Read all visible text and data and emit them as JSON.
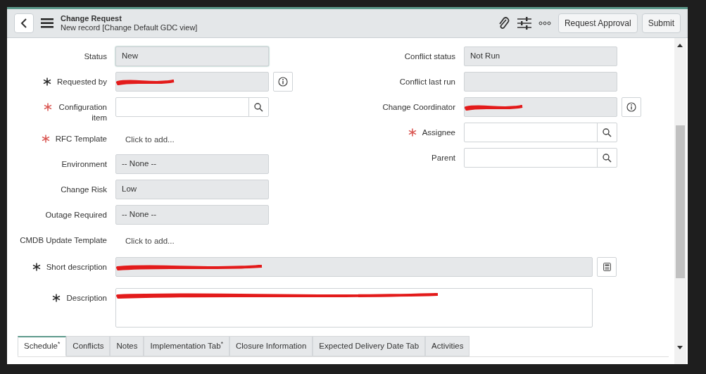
{
  "header": {
    "title": "Change Request",
    "subtitle": "New record [Change Default GDC view]",
    "buttons": [
      "Request Approval",
      "Submit"
    ]
  },
  "left_fields": [
    {
      "label": "Status",
      "kind": "text",
      "value": "New",
      "focused": true
    },
    {
      "label": "Requested by",
      "kind": "text",
      "mandatory": true,
      "mandatory_met": true,
      "redacted": true,
      "info": true
    },
    {
      "label": "Configuration item",
      "kind": "reference",
      "mandatory": true,
      "mandatory_met": false
    },
    {
      "label": "RFC Template",
      "kind": "click",
      "value": "Click to add...",
      "mandatory": true,
      "mandatory_met": false
    },
    {
      "label": "Environment",
      "kind": "text",
      "value": "-- None --"
    },
    {
      "label": "Change Risk",
      "kind": "text",
      "value": "Low"
    },
    {
      "label": "Outage Required",
      "kind": "text",
      "value": "-- None --"
    },
    {
      "label": "CMDB Update Template",
      "kind": "click",
      "value": "Click to add..."
    }
  ],
  "right_fields": [
    {
      "label": "Conflict status",
      "kind": "text",
      "value": "Not Run"
    },
    {
      "label": "Conflict last run",
      "kind": "text"
    },
    {
      "label": "Change Coordinator",
      "kind": "text",
      "redacted": true,
      "info": true
    },
    {
      "label": "Assignee",
      "kind": "reference",
      "mandatory": true,
      "mandatory_met": false
    },
    {
      "label": "Parent",
      "kind": "reference"
    }
  ],
  "wide_fields": [
    {
      "label": "Short description",
      "kind": "text",
      "mandatory": true,
      "mandatory_met": true,
      "redacted": true
    },
    {
      "label": "Description",
      "kind": "textarea",
      "mandatory": true,
      "mandatory_met": true,
      "redacted": true
    }
  ],
  "tabs": [
    {
      "label": "Schedule$^{*}$",
      "selected": true
    },
    {
      "label": "Conflicts",
      "selected": false
    },
    {
      "label": "Notes",
      "selected": false
    },
    {
      "label": "Implementation Tab$^{*}$",
      "selected": false
    },
    {
      "label": "Closure Information",
      "selected": false
    },
    {
      "label": "Expected Delivery Date Tab",
      "selected": false
    },
    {
      "label": "Activities",
      "selected": false
    }
  ]
}
